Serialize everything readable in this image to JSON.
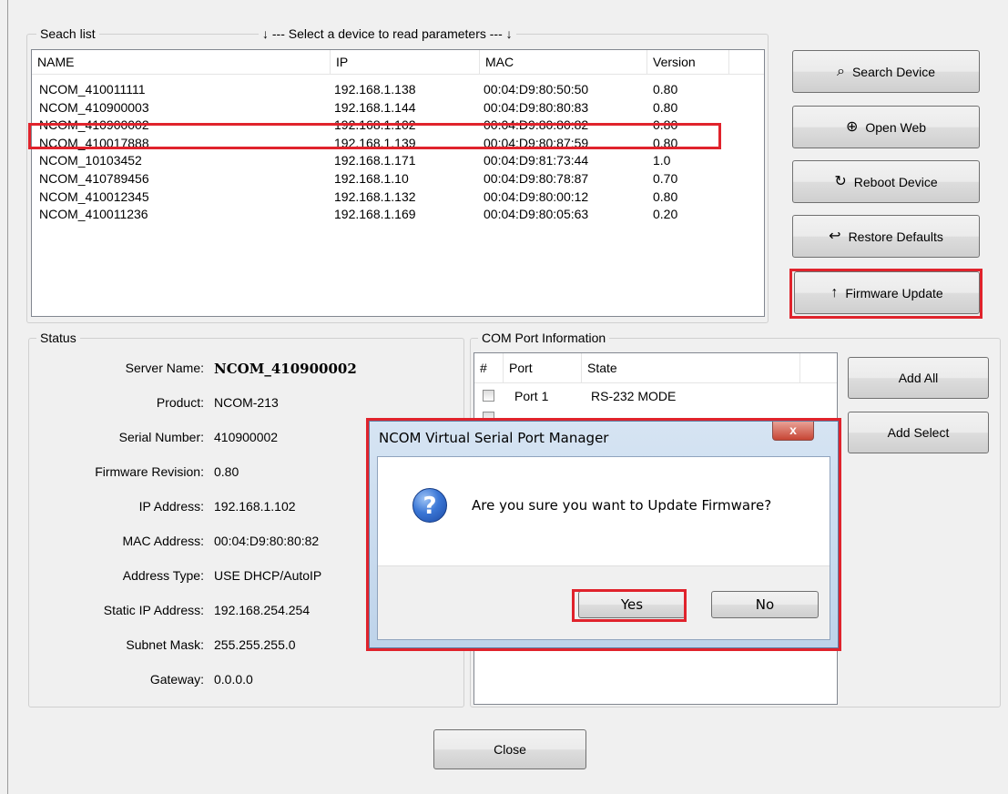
{
  "search_list": {
    "legend": "Seach list",
    "hint": "↓ --- Select a device to read parameters --- ↓",
    "columns": [
      "NAME",
      "IP",
      "MAC",
      "Version"
    ],
    "rows": [
      {
        "name": "NCOM_410011111",
        "ip": "192.168.1.138",
        "mac": "00:04:D9:80:50:50",
        "version": "0.80"
      },
      {
        "name": "NCOM_410900003",
        "ip": "192.168.1.144",
        "mac": "00:04:D9:80:80:83",
        "version": "0.80"
      },
      {
        "name": "NCOM_410900002",
        "ip": "192.168.1.102",
        "mac": "00:04:D9:80:80:82",
        "version": "0.80"
      },
      {
        "name": "NCOM_410017888",
        "ip": "192.168.1.139",
        "mac": "00:04:D9:80:87:59",
        "version": "0.80"
      },
      {
        "name": "NCOM_10103452",
        "ip": "192.168.1.171",
        "mac": "00:04:D9:81:73:44",
        "version": "1.0"
      },
      {
        "name": "NCOM_410789456",
        "ip": "192.168.1.10",
        "mac": "00:04:D9:80:78:87",
        "version": "0.70"
      },
      {
        "name": "NCOM_410012345",
        "ip": "192.168.1.132",
        "mac": "00:04:D9:80:00:12",
        "version": "0.80"
      },
      {
        "name": "NCOM_410011236",
        "ip": "192.168.1.169",
        "mac": "00:04:D9:80:05:63",
        "version": "0.20"
      }
    ]
  },
  "actions": {
    "search_device": {
      "label": "Search Device",
      "icon": "⌕"
    },
    "open_web": {
      "label": "Open Web",
      "icon": "⊕"
    },
    "reboot_device": {
      "label": "Reboot Device",
      "icon": "↻"
    },
    "restore_defaults": {
      "label": "Restore Defaults",
      "icon": "↩"
    },
    "firmware_update": {
      "label": "Firmware Update",
      "icon": "↑"
    }
  },
  "status": {
    "legend": "Status",
    "fields": [
      {
        "label": "Server Name:",
        "value": "NCOM_410900002"
      },
      {
        "label": "Product:",
        "value": "NCOM-213"
      },
      {
        "label": "Serial Number:",
        "value": "410900002"
      },
      {
        "label": "Firmware Revision:",
        "value": "0.80"
      },
      {
        "label": "IP Address:",
        "value": "192.168.1.102"
      },
      {
        "label": "MAC Address:",
        "value": "00:04:D9:80:80:82"
      },
      {
        "label": "Address Type:",
        "value": "USE DHCP/AutoIP"
      },
      {
        "label": "Static IP Address:",
        "value": "192.168.254.254"
      },
      {
        "label": "Subnet Mask:",
        "value": "255.255.255.0"
      },
      {
        "label": "Gateway:",
        "value": "0.0.0.0"
      }
    ]
  },
  "com_ports": {
    "legend": "COM Port Information",
    "columns": [
      "#",
      "Port",
      "State"
    ],
    "rows": [
      {
        "port": "Port 1",
        "state": "RS-232 MODE"
      }
    ],
    "add_all": "Add All",
    "add_select": "Add Select"
  },
  "close_button": "Close",
  "dialog": {
    "title": "NCOM Virtual Serial Port Manager",
    "close_glyph": "x",
    "icon_glyph": "?",
    "message": "Are you sure you want to Update Firmware?",
    "yes": "Yes",
    "no": "No"
  },
  "colors": {
    "highlight": "#e0232c",
    "window_bg": "#f0f0f0"
  }
}
